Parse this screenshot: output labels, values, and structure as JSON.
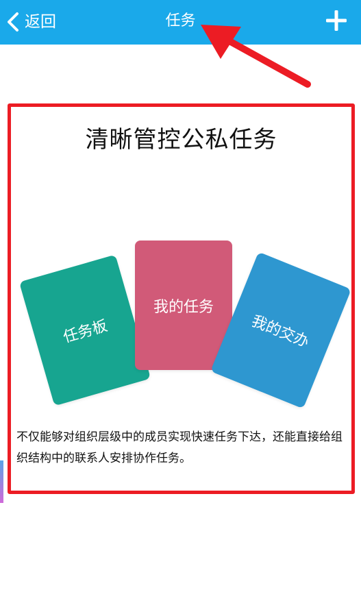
{
  "header": {
    "back_label": "返回",
    "title": "任务",
    "add_icon": "plus-icon",
    "back_icon": "chevron-left-icon",
    "bar_color": "#1aa9ea"
  },
  "annotation": {
    "arrow_color": "#ec1c24",
    "frame_color": "#ec1c24"
  },
  "promo": {
    "heading": "清晰管控公私任务",
    "cards": [
      {
        "label": "任务板",
        "color": "#17a590"
      },
      {
        "label": "我的任务",
        "color": "#d15a78"
      },
      {
        "label": "我的交办",
        "color": "#2e97d0"
      }
    ],
    "description": "不仅能够对组织层级中的成员实现快速任务下达，还能直接给组织结构中的联系人安排协作任务。"
  }
}
